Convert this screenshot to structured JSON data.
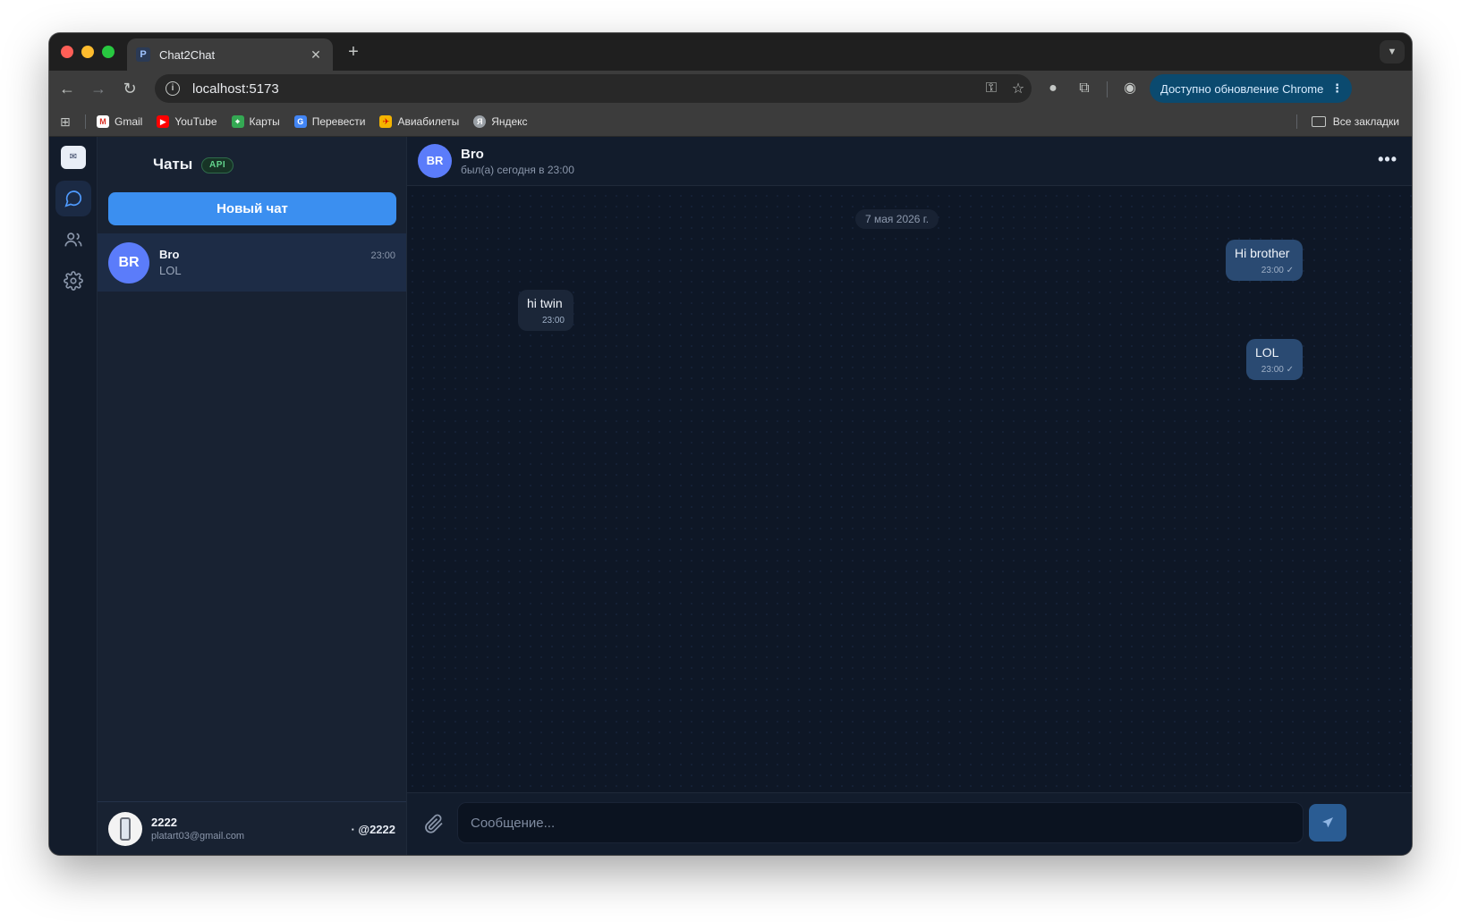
{
  "browser": {
    "tab_title": "Chat2Chat",
    "tab_favicon": "P",
    "url": "localhost:5173",
    "update_button": "Доступно обновление Chrome",
    "bookmarks": [
      {
        "label": "Gmail",
        "icon": "gmail-icon",
        "color": "#d93025"
      },
      {
        "label": "YouTube",
        "icon": "youtube-icon",
        "color": "#ff0000"
      },
      {
        "label": "Карты",
        "icon": "maps-icon",
        "color": "#34a853"
      },
      {
        "label": "Перевести",
        "icon": "translate-icon",
        "color": "#4285f4"
      },
      {
        "label": "Авиабилеты",
        "icon": "flights-icon",
        "color": "#f4b400"
      },
      {
        "label": "Яндекс",
        "icon": "yandex-icon",
        "color": "#9aa0a6"
      }
    ],
    "all_bookmarks": "Все закладки"
  },
  "rail": {
    "logo": "✉",
    "items": [
      {
        "name": "chats",
        "icon": "chat-bubble-icon",
        "active": true
      },
      {
        "name": "contacts",
        "icon": "users-icon",
        "active": false
      },
      {
        "name": "settings",
        "icon": "gear-icon",
        "active": false
      }
    ]
  },
  "chatlist": {
    "title": "Чаты",
    "badge": "API",
    "new_chat": "Новый чат",
    "chats": [
      {
        "initials": "BR",
        "name": "Bro",
        "last_message": "LOL",
        "time": "23:00"
      }
    ]
  },
  "profile": {
    "name": "2222",
    "email": "platart03@gmail.com",
    "handle": "· @2222"
  },
  "conversation": {
    "initials": "BR",
    "name": "Bro",
    "status": "был(а) сегодня в 23:00",
    "date_separator": "7 мая 2026 г.",
    "messages": [
      {
        "direction": "out",
        "text": "Hi brother",
        "time": "23:00",
        "check": "✓"
      },
      {
        "direction": "in",
        "text": "hi twin",
        "time": "23:00"
      },
      {
        "direction": "out",
        "text": "LOL",
        "time": "23:00",
        "check": "✓"
      }
    ]
  },
  "composer": {
    "placeholder": "Сообщение..."
  },
  "colors": {
    "accent": "#3b8ff0",
    "avatar": "#5b7cfa",
    "outgoing_bubble": "#2a4a72",
    "incoming_bubble": "#1b2638",
    "api_badge": "#62d48d"
  }
}
